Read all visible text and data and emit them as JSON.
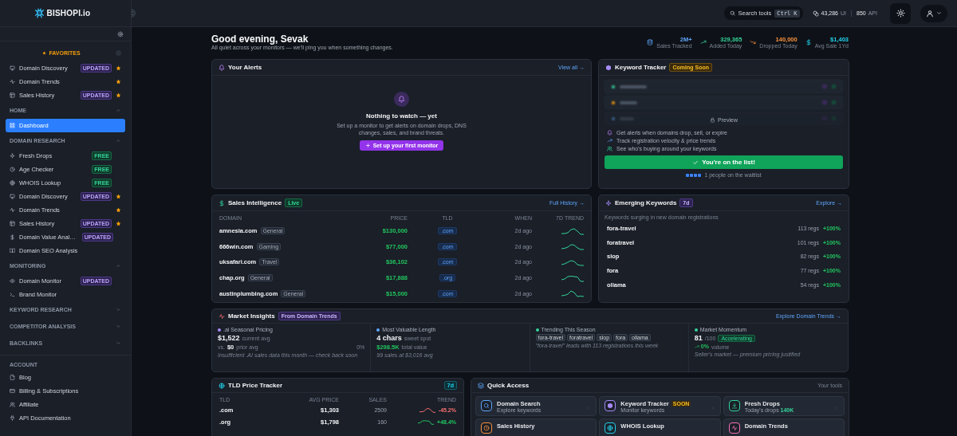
{
  "sidebar": {
    "brand": "BISHOPI.io",
    "sections": [
      {
        "title": "FAVORITES",
        "kind": "favorites",
        "items": [
          {
            "label": "Domain Discovery",
            "badge": "UPDATED",
            "kind": "updated",
            "starred": true,
            "selected": false
          },
          {
            "label": "Domain Trends",
            "kind": "plain",
            "starred": true,
            "selected": false
          },
          {
            "label": "Sales History",
            "badge": "UPDATED",
            "kind": "updated",
            "starred": true,
            "selected": false
          }
        ]
      },
      {
        "title": "HOME",
        "expanded": true,
        "items": [
          {
            "label": "Dashboard",
            "kind": "plain",
            "starred": false,
            "selected": true
          }
        ]
      },
      {
        "title": "DOMAIN RESEARCH",
        "expanded": true,
        "items": [
          {
            "label": "Fresh Drops",
            "badge": "FREE",
            "kind": "free",
            "starred": false,
            "selected": false
          },
          {
            "label": "Age Checker",
            "badge": "FREE",
            "kind": "free",
            "starred": false,
            "selected": false
          },
          {
            "label": "WHOIS Lookup",
            "badge": "FREE",
            "kind": "free",
            "starred": false,
            "selected": false
          },
          {
            "label": "Domain Discovery",
            "badge": "UPDATED",
            "kind": "updated",
            "starred": true,
            "selected": false
          },
          {
            "label": "Domain Trends",
            "kind": "plain",
            "starred": true,
            "selected": false
          },
          {
            "label": "Sales History",
            "badge": "UPDATED",
            "kind": "updated",
            "starred": true,
            "selected": false
          },
          {
            "label": "Domain Value Anal…",
            "badge": "UPDATED",
            "kind": "updated",
            "starred": false,
            "selected": false
          },
          {
            "label": "Domain SEO Analysis",
            "kind": "plain",
            "starred": false,
            "selected": false
          }
        ]
      },
      {
        "title": "MONITORING",
        "expanded": true,
        "items": [
          {
            "label": "Domain Monitor",
            "badge": "UPDATED",
            "kind": "updated",
            "starred": false,
            "selected": false
          },
          {
            "label": "Brand Monitor",
            "kind": "plain",
            "starred": false,
            "selected": false
          }
        ]
      },
      {
        "title": "KEYWORD RESEARCH",
        "expanded": false
      },
      {
        "title": "COMPETITOR ANALYSIS",
        "expanded": false
      },
      {
        "title": "BACKLINKS",
        "expanded": false
      },
      {
        "title": "ACCOUNT",
        "kind": "account",
        "items": [
          {
            "label": "Blog",
            "kind": "plain",
            "starred": false,
            "selected": false
          },
          {
            "label": "Billing & Subscriptions",
            "kind": "plain",
            "starred": false,
            "selected": false
          },
          {
            "label": "Affiliate",
            "kind": "plain",
            "starred": false,
            "selected": false
          },
          {
            "label": "API Documentation",
            "kind": "plain",
            "starred": false,
            "selected": false
          }
        ]
      }
    ]
  },
  "topbar": {
    "search": "Search tools",
    "shortcut": "Ctrl K",
    "credits_ui": "43,286",
    "credits_ui_label": "UI",
    "credits_api": "850",
    "credits_api_label": "API"
  },
  "greeting": {
    "title": "Good evening, Sevak",
    "subtitle": "All quiet across your monitors — we'll ping you when something changes."
  },
  "stats": [
    {
      "value": "2M+",
      "label": "Sales Tracked",
      "color": "#60a5fa"
    },
    {
      "value": "329,365",
      "label": "Added Today",
      "color": "#34d399"
    },
    {
      "value": "140,000",
      "label": "Dropped Today",
      "color": "#fb923c"
    },
    {
      "value": "$1,403",
      "label": "Avg Sale 1Yd",
      "color": "#22d3ee"
    }
  ],
  "alerts": {
    "title": "Your Alerts",
    "link": "View all →",
    "empty_title": "Nothing to watch — yet",
    "empty_text": "Set up a monitor to get alerts on domain drops, DNS changes, sales, and brand threats.",
    "button": "Set up your first monitor"
  },
  "keyword_tracker": {
    "title": "Keyword Tracker",
    "badge": "Coming Soon",
    "preview": "Preview",
    "features": [
      "Get alerts when domains drop, sell, or expire",
      "Track registration velocity & price trends",
      "See who's buying around your keywords"
    ],
    "button": "You're on the list!",
    "waitlist": "1 people on the waitlist"
  },
  "sales": {
    "title": "Sales Intelligence",
    "badge": "Live",
    "link": "Full History →",
    "columns": [
      "DOMAIN",
      "PRICE",
      "TLD",
      "WHEN",
      "7D TREND"
    ],
    "rows": [
      {
        "domain": "amnesia.com",
        "category": "General",
        "price": "$130,000",
        "tld": ".com",
        "when": "2d ago"
      },
      {
        "domain": "666win.com",
        "category": "Gaming",
        "price": "$77,000",
        "tld": ".com",
        "when": "2d ago"
      },
      {
        "domain": "uksafari.com",
        "category": "Travel",
        "price": "$36,102",
        "tld": ".com",
        "when": "2d ago"
      },
      {
        "domain": "chap.org",
        "category": "General",
        "price": "$17,888",
        "tld": ".org",
        "when": "2d ago"
      },
      {
        "domain": "austinplumbing.com",
        "category": "General",
        "price": "$15,000",
        "tld": ".com",
        "when": "2d ago"
      }
    ]
  },
  "emerging": {
    "title": "Emerging Keywords",
    "badge": "7d",
    "link": "Explore →",
    "subtitle": "Keywords surging in new domain registrations",
    "rows": [
      {
        "keyword": "fora-travel",
        "regs": "113 regs",
        "change": "+100%"
      },
      {
        "keyword": "foratravel",
        "regs": "101 regs",
        "change": "+100%"
      },
      {
        "keyword": "slop",
        "regs": "82 regs",
        "change": "+100%"
      },
      {
        "keyword": "fora",
        "regs": "77 regs",
        "change": "+100%"
      },
      {
        "keyword": "ollama",
        "regs": "54 regs",
        "change": "+100%"
      }
    ]
  },
  "insights": {
    "title": "Market Insights",
    "badge": "From Domain Trends",
    "link": "Explore Domain Trends →",
    "items": [
      {
        "kind": "pricing",
        "title": ".ai Seasonal Pricing",
        "color": "#a78bfa",
        "value": "$1,522",
        "value_note": "current avg",
        "compare_prefix": "vs.",
        "compare_value": "$0",
        "compare_note": "prior avg",
        "change": "0%",
        "note": "Insufficient .AI sales data this month — check back soon"
      },
      {
        "kind": "length",
        "title": "Most Valuable Length",
        "color": "#60a5fa",
        "value": "4 chars",
        "value_note": "sweet spot",
        "total": "$298.5K",
        "total_note": "total value",
        "note": "99 sales at $3,016 avg"
      },
      {
        "kind": "trending",
        "title": "Trending This Season",
        "color": "#34d399",
        "tags": [
          "fora-travel",
          "foratravel",
          "slop",
          "fora",
          "ollama"
        ],
        "note": "\"fora-travel\" leads with 113 registrations this week"
      },
      {
        "kind": "momentum",
        "title": "Market Momentum",
        "color": "#34d399",
        "value": "81",
        "scale": "/100",
        "status": "Accelerating",
        "change": "0%",
        "change_note": "volume",
        "note": "Seller's market — premium pricing justified"
      }
    ]
  },
  "tld_tracker": {
    "title": "TLD Price Tracker",
    "badge": "7d",
    "columns": [
      "TLD",
      "AVG PRICE",
      "SALES",
      "TREND"
    ],
    "rows": [
      {
        "tld": ".com",
        "price": "$1,303",
        "sales": "2509",
        "change": "-45.2%",
        "kind": "down"
      },
      {
        "tld": ".org",
        "price": "$1,798",
        "sales": "160",
        "change": "+48.4%",
        "kind": "up"
      }
    ]
  },
  "quick_access": {
    "title": "Quick Access",
    "note": "Your tools",
    "tiles": [
      {
        "title": "Domain Search",
        "subtitle": "Explore keywords",
        "color": "#60a5fa"
      },
      {
        "title": "Keyword Tracker",
        "badge": "SOON",
        "subtitle": "Monitor keywords",
        "color": "#a78bfa"
      },
      {
        "title": "Fresh Drops",
        "subtitle": "Today's drops",
        "count": "140K",
        "color": "#34d399"
      },
      {
        "title": "Sales History",
        "color": "#fb923c"
      },
      {
        "title": "WHOIS Lookup",
        "color": "#22d3ee"
      },
      {
        "title": "Domain Trends",
        "color": "#f472b6"
      }
    ]
  }
}
